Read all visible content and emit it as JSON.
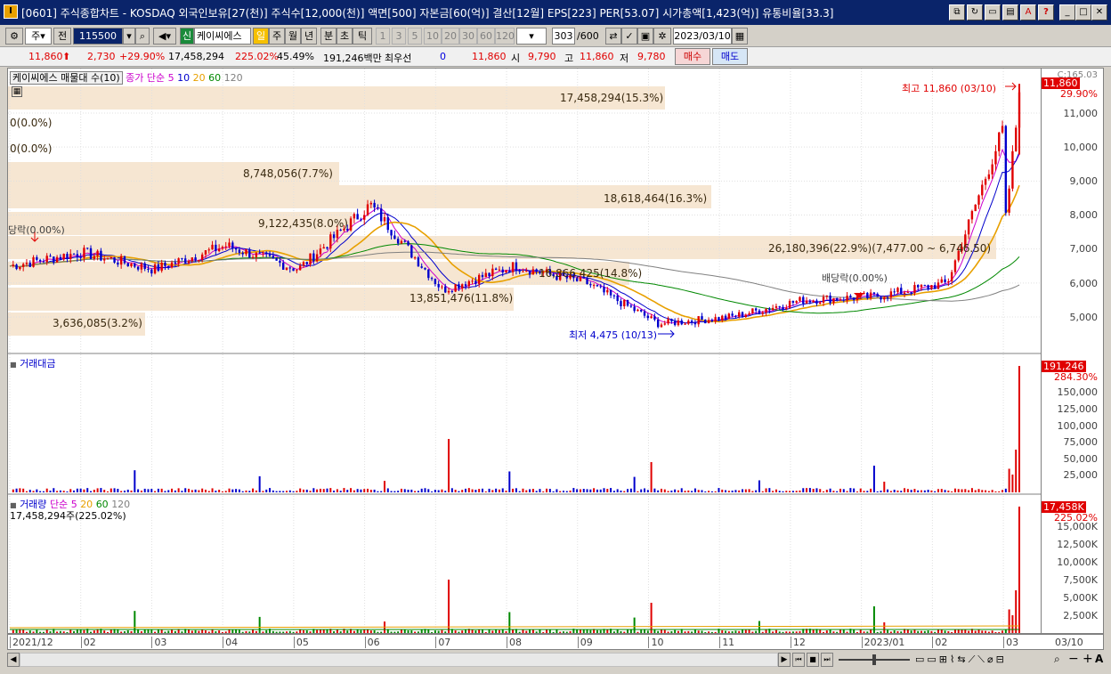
{
  "window": {
    "title": "[0601] 주식종합차트 - KOSDAQ 외국인보유[27(천)] 주식수[12,000(천)] 액면[500] 자본금[60(억)] 결산[12월] EPS[223] PER[53.07] 시가총액[1,423(억)] 유통비율[33.3]",
    "icon_label": "I"
  },
  "toolbar": {
    "period_select": "주",
    "prev_label": "전",
    "code": "115500",
    "new_badge": "신",
    "stock_name": "케이씨에스",
    "periods": [
      "일",
      "주",
      "월",
      "년",
      "분",
      "초",
      "틱"
    ],
    "intervals": [
      "1",
      "3",
      "5",
      "10",
      "20",
      "30",
      "60",
      "120"
    ],
    "count": "303",
    "count_total": "/600",
    "date": "2023/03/10"
  },
  "quote": {
    "price": "11,860",
    "change": "2,730",
    "change_pct": "+29.90%",
    "volume": "17,458,294",
    "vol_ratio": "225.02%",
    "turnover": "45.49%",
    "amount": "191,246백만",
    "priority_label": "최우선",
    "priority_val": "0",
    "ask": "11,860",
    "open_label": "시",
    "open": "9,790",
    "high_label": "고",
    "high": "11,860",
    "low_label": "저",
    "low": "9,780",
    "buy_label": "매수",
    "sell_label": "매도"
  },
  "price_panel": {
    "title": "케이씨에스 매물대 수(10)",
    "ma_label": "종가 단순",
    "ma": [
      "5",
      "10",
      "20",
      "60",
      "120"
    ],
    "ma_colors": [
      "#cc00cc",
      "#0000cc",
      "#e8a000",
      "#008800",
      "#808080"
    ],
    "y_ticks": [
      "11,000",
      "10,000",
      "9,000",
      "8,000",
      "7,000",
      "6,000",
      "5,000"
    ],
    "top_label": "C:165.03",
    "last_price": "11,860",
    "last_pct": "29.90%",
    "high_note": "최고 11,860 (03/10)",
    "low_note": "최저 4,475 (10/13)",
    "dividend_note_1": "배당락(0.00%)",
    "dividend_note_2": "당락(0.00%)",
    "volume_profile": [
      "17,458,294(15.3%)",
      "0(0.0%)",
      "0(0.0%)",
      "8,748,056(7.7%)",
      "18,618,464(16.3%)",
      "9,122,435(8.0%)",
      "26,180,396(22.9%)(7,477.00 ~ 6,746.50)",
      "16,866,425(14.8%)",
      "13,851,476(11.8%)",
      "3,636,085(3.2%)"
    ]
  },
  "amount_panel": {
    "title": "거래대금",
    "y_ticks": [
      "150,000",
      "125,000",
      "100,000",
      "75,000",
      "50,000",
      "25,000"
    ],
    "last": "191,246",
    "last_pct": "284.30%"
  },
  "volume_panel": {
    "title": "거래량",
    "ma_label": "단순",
    "ma": [
      "5",
      "20",
      "60",
      "120"
    ],
    "sub": "17,458,294주(225.02%)",
    "y_ticks": [
      "15,000K",
      "12,500K",
      "10,000K",
      "7,500K",
      "5,000K",
      "2,500K"
    ],
    "last": "17,458K",
    "last_pct": "225.02%"
  },
  "date_axis": [
    "2021/12",
    "02",
    "03",
    "04",
    "05",
    "06",
    "07",
    "08",
    "09",
    "10",
    "11",
    "12",
    "2023/01",
    "02",
    "03"
  ],
  "date_axis_end": "03/10",
  "chart_data": {
    "type": "line",
    "title": "케이씨에스",
    "x": [
      "2021/12",
      "02",
      "03",
      "04",
      "05",
      "06",
      "07",
      "08",
      "09",
      "10",
      "11",
      "12",
      "2023/01",
      "02",
      "03"
    ],
    "series": [
      {
        "name": "종가",
        "values": [
          6500,
          6900,
          6400,
          7100,
          6400,
          8300,
          5800,
          6500,
          6000,
          4800,
          5000,
          5500,
          5600,
          6000,
          11860
        ]
      }
    ],
    "ylim": [
      4000,
      12000
    ],
    "high": 11860,
    "low": 4475
  }
}
